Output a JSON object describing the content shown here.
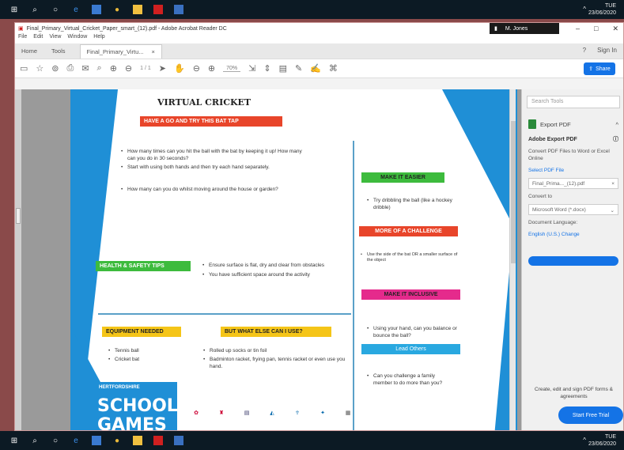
{
  "taskbar": {
    "icons": [
      "windows-icon",
      "search-icon",
      "task-view-icon",
      "edge-icon",
      "store-icon",
      "chrome-icon",
      "files-icon",
      "acrobat-icon",
      "app-icon"
    ],
    "time": "TUE",
    "date": "23/06/2020"
  },
  "window": {
    "title": "Final_Primary_Virtual_Cricket_Paper_smart_(12).pdf - Adobe Acrobat Reader DC",
    "user": "M. Jones",
    "menu": [
      "File",
      "Edit",
      "View",
      "Window",
      "Help"
    ]
  },
  "tabs": {
    "home": "Home",
    "tools": "Tools",
    "doc": "Final_Primary_Virtu...",
    "sign_in": "Sign In"
  },
  "toolbar": {
    "page_indicator": "1 / 1",
    "zoom": "70%",
    "share": "Share"
  },
  "page": {
    "title": "VIRTUAL CRICKET",
    "header1": "HAVE A GO AND TRY THIS BAT TAP",
    "bullets1": [
      "How many times can you hit the ball with the bat by keeping it up! How many can you do in 30 seconds?",
      "Start with using both hands and then try each hand separately.",
      "How many can you do whilst moving around the house or garden?"
    ],
    "health_header": "HEALTH & SAFETY TIPS",
    "health_bullets": [
      "Ensure surface is flat, dry and clear from obstacles",
      "You have sufficient space around the activity"
    ],
    "equipment_header": "EQUIPMENT NEEDED",
    "equipment_bullets": [
      "Tennis ball",
      "Cricket bat"
    ],
    "else_header": "BUT WHAT ELSE CAN I USE?",
    "else_bullets": [
      "Rolled up socks or tin foil",
      "Badminton racket, frying pan, tennis racket or even use you hand."
    ],
    "easier_header": "MAKE IT EASIER",
    "easier_bullets": [
      "Try dribbling the ball (like a hockey dribble)"
    ],
    "challenge_header": "MORE OF A CHALLENGE",
    "challenge_bullets": [
      "Use the side of the bat OR a smaller surface of the object"
    ],
    "inclusive_header": "MAKE IT INCLUSIVE",
    "inclusive_bullets": [
      "Using your hand, can you balance or bounce the ball?"
    ],
    "lead_header": "Lead Others",
    "lead_bullets": [
      "Can you challenge a family member to do more than you?"
    ],
    "logo_small": "HERTFORDSHIRE",
    "logo_big1": "SCHOOL",
    "logo_big2": "GAMES"
  },
  "rightpane": {
    "search_placeholder": "Search Tools",
    "export_label": "Export PDF",
    "adobe_export": "Adobe Export PDF",
    "convert_desc": "Convert PDF Files to Word or Excel Online",
    "select_file": "Select PDF File",
    "file_name": "Final_Prima..._(12).pdf",
    "convert_to": "Convert to",
    "convert_value": "Microsoft Word (*.docx)",
    "doc_lang": "Document Language:",
    "lang_value": "English (U.S.) Change",
    "create_text": "Create, edit and sign PDF forms & agreements",
    "trial_button": "Start Free Trial"
  }
}
